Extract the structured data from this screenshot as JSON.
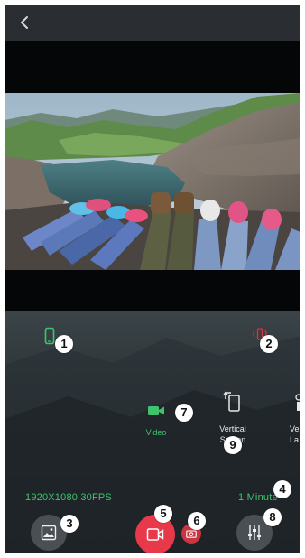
{
  "colors": {
    "accent_green": "#3fc46d",
    "record_red": "#e8394a",
    "snapshot_red": "#c9363f"
  },
  "header": {
    "back_icon": "chevron-left-icon"
  },
  "status": {
    "left_icon": "phone-portrait-icon",
    "right_icon": "shake-icon"
  },
  "modes": {
    "video_label": "Video",
    "vertical_line1": "Vertical",
    "vertical_line2": "Screen",
    "third_line1": "Ve",
    "third_line2": "La"
  },
  "info": {
    "resolution": "1920X1080 30FPS",
    "duration": "1 Minute"
  },
  "bottom_bar": {
    "gallery_icon": "gallery-icon",
    "record_icon": "video-record-icon",
    "snapshot_icon": "camera-icon",
    "settings_icon": "sliders-icon"
  },
  "callouts": [
    "1",
    "2",
    "3",
    "4",
    "5",
    "6",
    "7",
    "8",
    "9"
  ]
}
